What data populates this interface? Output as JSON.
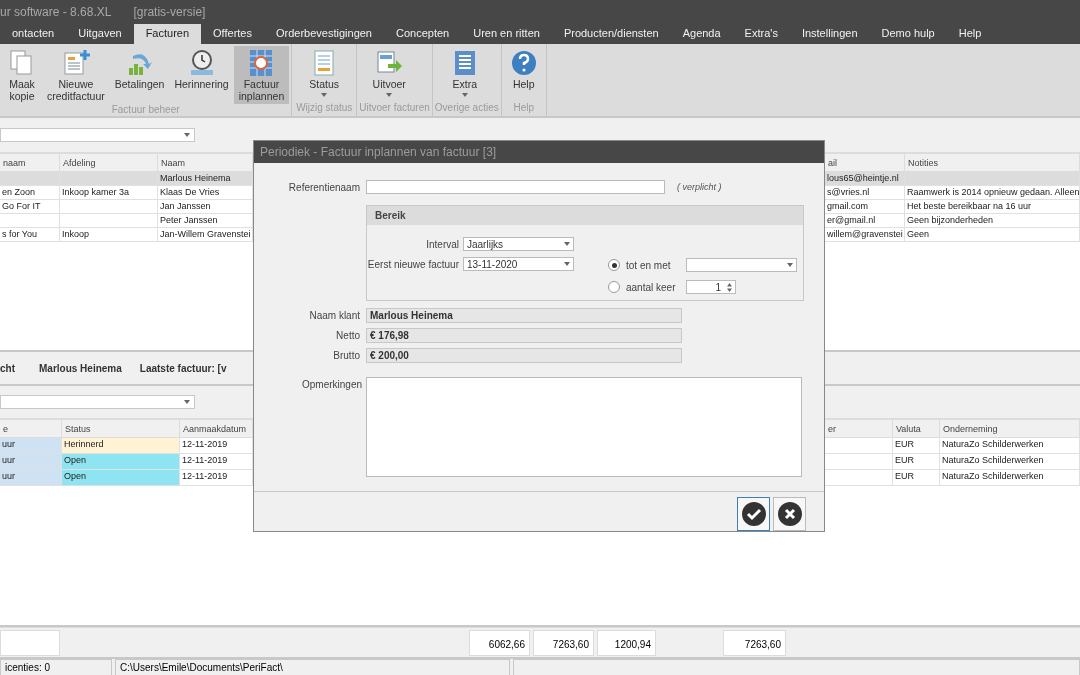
{
  "window": {
    "title": "ur software - 8.68.XL",
    "edition": "[gratis-versie]"
  },
  "menu_tabs": [
    {
      "label": "ontacten",
      "selected": false
    },
    {
      "label": "Uitgaven",
      "selected": false
    },
    {
      "label": "Facturen",
      "selected": true
    },
    {
      "label": "Offertes",
      "selected": false
    },
    {
      "label": "Orderbevestigingen",
      "selected": false
    },
    {
      "label": "Concepten",
      "selected": false
    },
    {
      "label": "Uren en ritten",
      "selected": false
    },
    {
      "label": "Producten/diensten",
      "selected": false
    },
    {
      "label": "Agenda",
      "selected": false
    },
    {
      "label": "Extra's",
      "selected": false
    },
    {
      "label": "Instellingen",
      "selected": false
    },
    {
      "label": "Demo hulp",
      "selected": false
    },
    {
      "label": "Help",
      "selected": false
    }
  ],
  "ribbon": {
    "groups": [
      {
        "label": "Factuur beheer",
        "buttons": [
          {
            "kind": "copy",
            "lines": [
              "Maak",
              "kopie"
            ],
            "selected": false,
            "dropdown": false
          },
          {
            "kind": "credit",
            "lines": [
              "Nieuwe",
              "creditfactuur"
            ],
            "selected": false,
            "dropdown": false
          },
          {
            "kind": "payments",
            "lines": [
              "Betalingen"
            ],
            "selected": false,
            "dropdown": false
          },
          {
            "kind": "reminder",
            "lines": [
              "Herinnering"
            ],
            "selected": false,
            "dropdown": false
          },
          {
            "kind": "schedule",
            "lines": [
              "Factuur",
              "inplannen"
            ],
            "selected": true,
            "dropdown": false
          }
        ]
      },
      {
        "label": "Wijzig status",
        "buttons": [
          {
            "kind": "status",
            "lines": [
              "Status"
            ],
            "selected": false,
            "dropdown": true
          }
        ]
      },
      {
        "label": "Uitvoer facturen",
        "buttons": [
          {
            "kind": "export",
            "lines": [
              "Uitvoer"
            ],
            "selected": false,
            "dropdown": true
          }
        ]
      },
      {
        "label": "Overige acties",
        "buttons": [
          {
            "kind": "extra",
            "lines": [
              "Extra"
            ],
            "selected": false,
            "dropdown": true
          }
        ]
      },
      {
        "label": "Help",
        "buttons": [
          {
            "kind": "help",
            "lines": [
              "Help"
            ],
            "selected": false,
            "dropdown": false
          }
        ]
      }
    ]
  },
  "contacts_table": {
    "columns": [
      "naam",
      "Afdeling",
      "Naam",
      "ail",
      "Notities"
    ],
    "rows": [
      {
        "selected": true,
        "cells": [
          "",
          "",
          "Marlous Heinema",
          "lous65@heintje.nl",
          ""
        ]
      },
      {
        "selected": false,
        "cells": [
          "en Zoon",
          "Inkoop kamer 3a",
          "Klaas De Vries",
          "s@vries.nl",
          "Raamwerk is 2014 opnieuw gedaan. Alleen"
        ]
      },
      {
        "selected": false,
        "cells": [
          "Go For IT",
          "",
          "Jan Janssen",
          "gmail.com",
          "Het beste bereikbaar na 16 uur"
        ]
      },
      {
        "selected": false,
        "cells": [
          "",
          "",
          "Peter Janssen",
          "er@gmail.nl",
          "Geen bijzonderheden"
        ]
      },
      {
        "selected": false,
        "cells": [
          "s for You",
          "Inkoop",
          "Jan-Willem Gravenstei",
          "willem@gravenstei",
          "Geen"
        ]
      }
    ]
  },
  "summary": {
    "left": "cht",
    "name": "Marlous Heinema",
    "last_invoice": "Laatste factuur: [v"
  },
  "invoices_table": {
    "columns": [
      "e",
      "Status",
      "Aanmaakdatum",
      "er",
      "Valuta",
      "Onderneming"
    ],
    "rows": [
      {
        "color": "#fff2d5",
        "cells": [
          "uur",
          "Herinnerd",
          "12-11-2019",
          "",
          "EUR",
          "NaturaZo Schilderwerken"
        ]
      },
      {
        "color": "#8ee4f0",
        "cells": [
          "uur",
          "Open",
          "12-11-2019",
          "",
          "EUR",
          "NaturaZo Schilderwerken"
        ]
      },
      {
        "color": "#8ee4f0",
        "cells": [
          "uur",
          "Open",
          "12-11-2019",
          "",
          "EUR",
          "NaturaZo Schilderwerken"
        ]
      }
    ]
  },
  "totals": [
    "6062,66",
    "7263,60",
    "1200,94",
    "7263,60"
  ],
  "status_bar": [
    "icenties: 0",
    "C:\\Users\\Emile\\Documents\\PeriFact\\"
  ],
  "dialog": {
    "title": "Periodiek - Factuur inplannen van factuur [3]",
    "reference": {
      "label": "Referentienaam",
      "note": "( verplicht )"
    },
    "range": {
      "title": "Bereik",
      "interval_label": "Interval",
      "interval": "Jaarlijks",
      "first_label": "Eerst nieuwe factuur",
      "first": "13-11-2020",
      "options": [
        {
          "kind": "dropdown",
          "label": "tot en met",
          "selected": true
        },
        {
          "kind": "spin",
          "label": "aantal keer",
          "selected": false,
          "value": "1"
        }
      ]
    },
    "readonly": [
      {
        "label": "Naam klant",
        "value": "Marlous Heinema"
      },
      {
        "label": "Netto",
        "value": "€ 176,98"
      },
      {
        "label": "Brutto",
        "value": "€ 200,00"
      }
    ],
    "remarks_label": "Opmerkingen",
    "buttons": [
      {
        "kind": "confirm",
        "focused": true
      },
      {
        "kind": "cancel",
        "focused": false
      }
    ]
  }
}
